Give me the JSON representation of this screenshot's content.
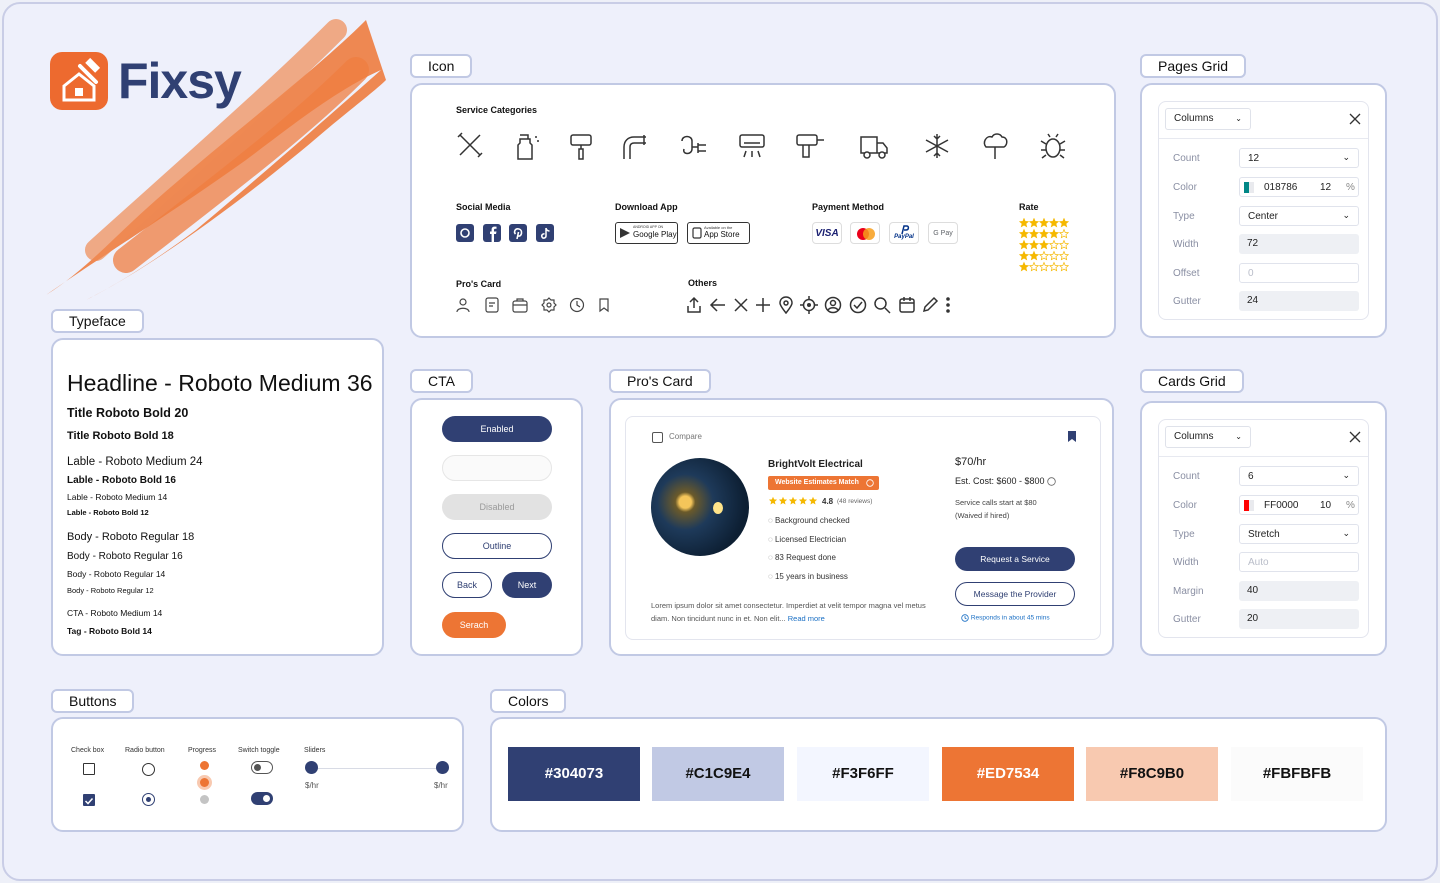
{
  "brand": {
    "name": "Fixsy"
  },
  "sections": {
    "icon": "Icon",
    "pages_grid": "Pages Grid",
    "typeface": "Typeface",
    "cta": "CTA",
    "pros_card": "Pro's Card",
    "cards_grid": "Cards Grid",
    "buttons": "Buttons",
    "colors": "Colors"
  },
  "icon_panel": {
    "service_categories": "Service Categories",
    "social_media": "Social Media",
    "download_app": "Download App",
    "payment_method": "Payment Method",
    "rate": "Rate",
    "pros_card": "Pro's Card",
    "others": "Others",
    "google_play_small": "ANDROID APP ON",
    "google_play": "Google Play",
    "app_store_small": "Available on the",
    "app_store": "App Store",
    "visa": "VISA",
    "paypal": "PayPal",
    "gpay": "G Pay"
  },
  "typeface": {
    "headline": "Headline - Roboto Medium 36",
    "title20": "Title Roboto Bold 20",
    "title18": "Title Roboto Bold 18",
    "label24": "Lable - Roboto Medium 24",
    "label16": "Lable - Roboto Bold 16",
    "label14": "Lable - Roboto Medium 14",
    "label12": "Lable - Roboto Bold 12",
    "body18": "Body - Roboto Regular 18",
    "body16": "Body - Roboto Regular 16",
    "body14": "Body - Roboto Regular 14",
    "body12": "Body - Roboto Regular 12",
    "cta14": "CTA - Roboto Medium 14",
    "tag14": "Tag - Roboto Bold 14"
  },
  "cta": {
    "enabled": "Enabled",
    "disabled": "Disabled",
    "outline": "Outline",
    "back": "Back",
    "next": "Next",
    "search": "Serach"
  },
  "pro_card": {
    "compare": "Compare",
    "name": "BrightVolt Electrical",
    "badge": "Website Estimates Match",
    "rating": "4.8",
    "reviews": "(48 reviews)",
    "features": [
      "Background checked",
      "Licensed Electrician",
      "83 Request done",
      "15 years in business"
    ],
    "rate": "$70/hr",
    "est_cost": "Est. Cost: $600 - $800",
    "service_calls": "Service calls start at $80",
    "waived": "(Waived if hired)",
    "request_btn": "Request a Service",
    "message_btn": "Message the Provider",
    "responds": "Responds in about 45 mins",
    "description": "Lorem ipsum dolor sit amet consectetur. Imperdiet at velit tempor magna vel metus diam. Non tincidunt nunc in et. Non elit...",
    "read_more": "Read more"
  },
  "pages_grid": {
    "dropdown": "Columns",
    "rows": [
      {
        "label": "Count",
        "value": "12"
      },
      {
        "label": "Color",
        "value": "018786",
        "opacity": "12",
        "unit": "%"
      },
      {
        "label": "Type",
        "value": "Center"
      },
      {
        "label": "Width",
        "value": "72"
      },
      {
        "label": "Offset",
        "value": "0"
      },
      {
        "label": "Gutter",
        "value": "24"
      }
    ],
    "swatch_color": "#018786"
  },
  "cards_grid": {
    "dropdown": "Columns",
    "rows": [
      {
        "label": "Count",
        "value": "6"
      },
      {
        "label": "Color",
        "value": "FF0000",
        "opacity": "10",
        "unit": "%"
      },
      {
        "label": "Type",
        "value": "Stretch"
      },
      {
        "label": "Width",
        "value": "Auto"
      },
      {
        "label": "Margin",
        "value": "40"
      },
      {
        "label": "Gutter",
        "value": "20"
      }
    ],
    "swatch_color": "#FF0000"
  },
  "buttons_panel": {
    "checkbox": "Check box",
    "radio": "Radio button",
    "progress": "Progress",
    "switch": "Switch toggle",
    "sliders": "Sliders",
    "slider_unit_left": "$/hr",
    "slider_unit_right": "$/hr"
  },
  "colors": [
    {
      "hex": "#304073",
      "label": "#304073",
      "text": "#ffffff"
    },
    {
      "hex": "#C1C9E4",
      "label": "#C1C9E4",
      "text": "#111111"
    },
    {
      "hex": "#F3F6FF",
      "label": "#F3F6FF",
      "text": "#111111"
    },
    {
      "hex": "#ED7534",
      "label": "#ED7534",
      "text": "#ffffff"
    },
    {
      "hex": "#F8C9B0",
      "label": "#F8C9B0",
      "text": "#111111"
    },
    {
      "hex": "#FBFBFB",
      "label": "#FBFBFB",
      "text": "#111111"
    }
  ]
}
